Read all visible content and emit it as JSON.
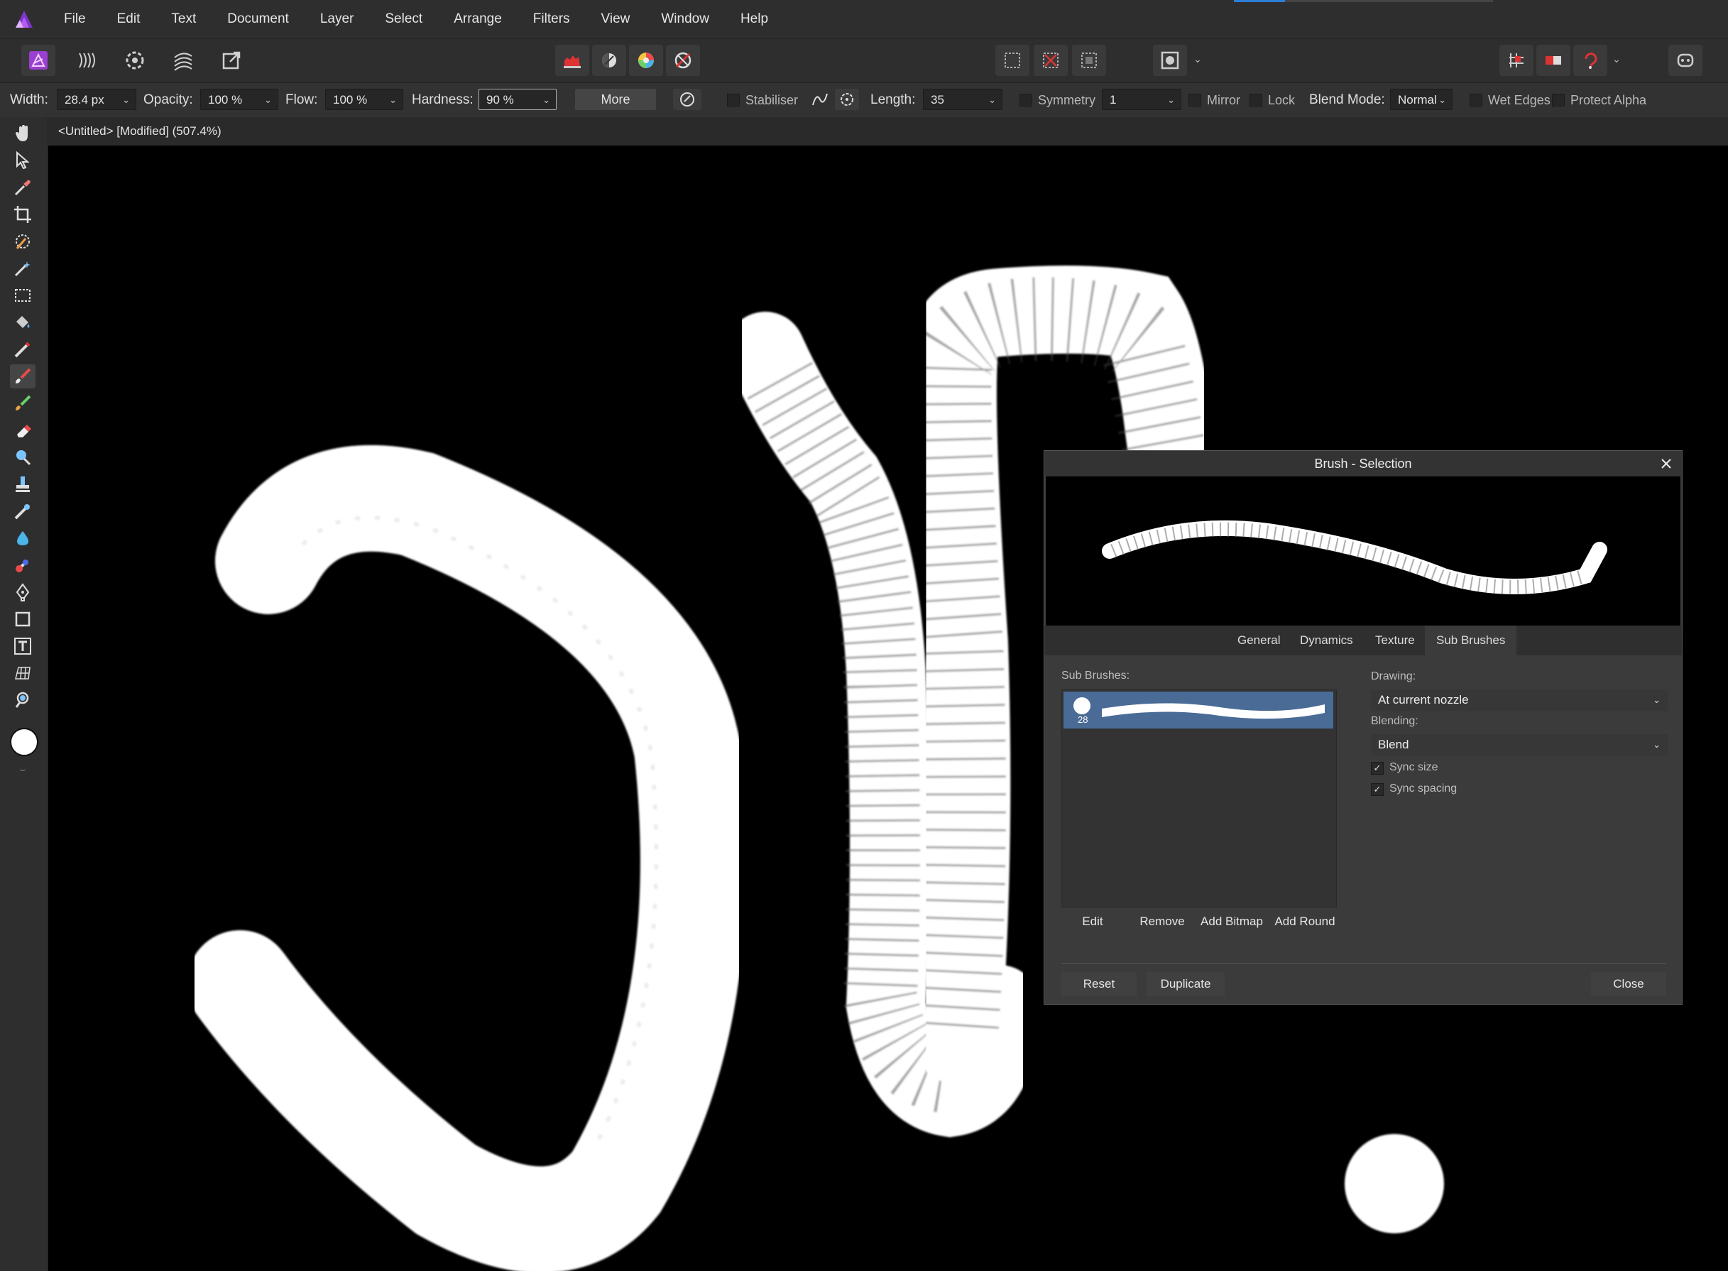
{
  "menubar": {
    "items": [
      "File",
      "Edit",
      "Text",
      "Document",
      "Layer",
      "Select",
      "Arrange",
      "Filters",
      "View",
      "Window",
      "Help"
    ]
  },
  "context": {
    "width_label": "Width:",
    "width_value": "28.4 px",
    "opacity_label": "Opacity:",
    "opacity_value": "100 %",
    "flow_label": "Flow:",
    "flow_value": "100 %",
    "hardness_label": "Hardness:",
    "hardness_value": "90 %",
    "more_label": "More",
    "stabiliser_label": "Stabiliser",
    "length_label": "Length:",
    "length_value": "35",
    "symmetry_label": "Symmetry",
    "symmetry_value": "1",
    "mirror_label": "Mirror",
    "lock_label": "Lock",
    "blend_mode_label": "Blend Mode:",
    "blend_mode_value": "Normal",
    "wet_edges_label": "Wet Edges",
    "protect_alpha_label": "Protect Alpha"
  },
  "document": {
    "title": "<Untitled> [Modified] (507.4%)"
  },
  "dialog": {
    "title": "Brush - Selection",
    "tabs": [
      "General",
      "Dynamics",
      "Texture",
      "Sub Brushes"
    ],
    "active_tab": "Sub Brushes",
    "sub_brushes_label": "Sub Brushes:",
    "sub_brush_size": "28",
    "list_buttons": [
      "Edit",
      "Remove",
      "Add Bitmap",
      "Add Round"
    ],
    "drawing_label": "Drawing:",
    "drawing_value": "At current nozzle",
    "blending_label": "Blending:",
    "blending_value": "Blend",
    "sync_size_label": "Sync size",
    "sync_size_checked": true,
    "sync_spacing_label": "Sync spacing",
    "sync_spacing_checked": true,
    "reset_label": "Reset",
    "duplicate_label": "Duplicate",
    "close_label": "Close"
  },
  "colors": {
    "accent_blue": "#2d7fd6",
    "selected_row": "#4a6b96",
    "app_purple": "#9a3fd0"
  }
}
